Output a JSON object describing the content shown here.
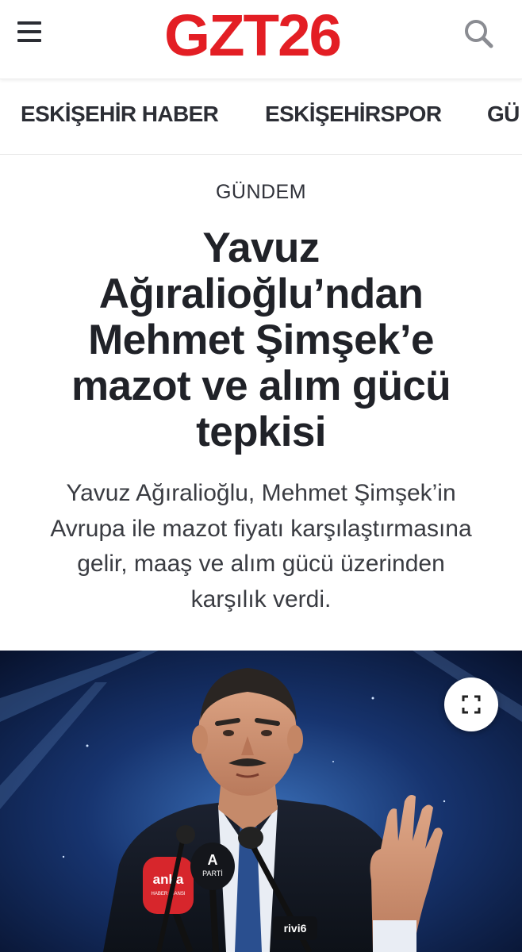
{
  "header": {
    "logo_text": "GZT26",
    "menu_icon": "hamburger-menu-icon",
    "search_icon": "search-icon",
    "brand_color": "#e31e24"
  },
  "nav": {
    "items": [
      "ESKİŞEHİR HABER",
      "ESKİŞEHİRSPOR",
      "GÜ"
    ]
  },
  "article": {
    "category": "GÜNDEM",
    "title_lines": [
      "Yavuz",
      "Ağıralioğlu’ndan",
      "Mehmet Şimşek’e",
      "mazot ve alım gücü",
      "tepkisi"
    ],
    "summary_lines": [
      "Yavuz Ağıralioğlu, Mehmet Şimşek’in",
      "Avrupa ile mazot fiyatı karşılaştırmasına",
      "gelir, maaş ve alım gücü üzerinden",
      "karşılık verdi."
    ]
  },
  "hero_image": {
    "expand_icon": "expand-fullscreen-icon",
    "mic_labels": [
      "anka",
      "HABER AJANSI",
      "A",
      "PARTİ",
      "rivi6"
    ]
  }
}
